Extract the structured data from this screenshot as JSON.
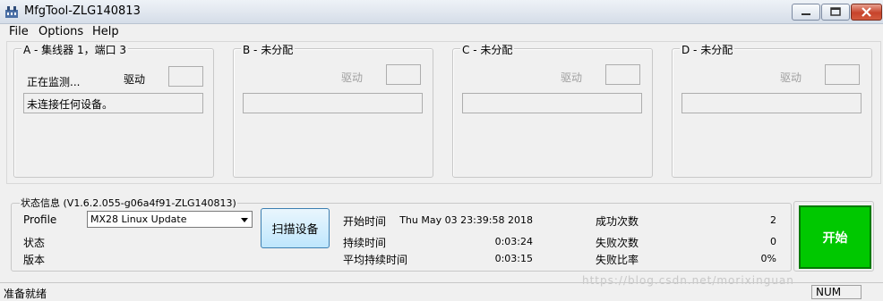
{
  "window": {
    "title": "MfgTool-ZLG140813"
  },
  "menu": {
    "file": "File",
    "options": "Options",
    "help": "Help"
  },
  "panels": [
    {
      "title": "A - 集线器 1，端口 3",
      "monitor": "正在监测...",
      "driver_label": "驱动",
      "status": "未连接任何设备。"
    },
    {
      "title": "B - 未分配",
      "driver_label": "驱动"
    },
    {
      "title": "C - 未分配",
      "driver_label": "驱动"
    },
    {
      "title": "D - 未分配",
      "driver_label": "驱动"
    }
  ],
  "info": {
    "title": "状态信息 (V1.6.2.055-g06a4f91-ZLG140813)",
    "profile_label": "Profile",
    "profile_value": "MX28 Linux Update",
    "state_label": "状态",
    "version_label": "版本",
    "scan_button": "扫描设备",
    "start_time_label": "开始时间",
    "start_time_value": "Thu May 03 23:39:58 2018",
    "duration_label": "持续时间",
    "duration_value": "0:03:24",
    "avg_duration_label": "平均持续时间",
    "avg_duration_value": "0:03:15",
    "success_label": "成功次数",
    "success_value": "2",
    "fail_label": "失败次数",
    "fail_value": "0",
    "fail_rate_label": "失败比率",
    "fail_rate_value": "0%",
    "start_button": "开始"
  },
  "statusbar": {
    "ready": "准备就绪",
    "num": "NUM"
  },
  "watermark": "https://blog.csdn.net/morixinguan",
  "colors": {
    "start_green": "#00c800"
  }
}
